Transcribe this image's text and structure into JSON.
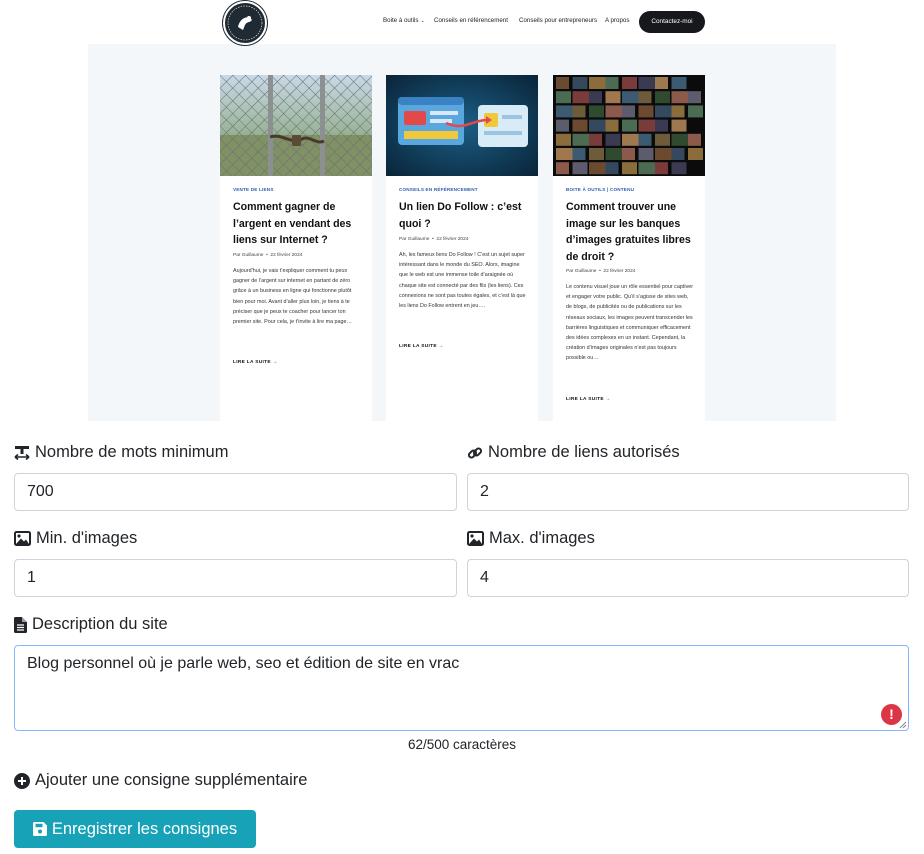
{
  "preview": {
    "nav": {
      "items": [
        "Boite à outils",
        "Conseils en référencement",
        "Conseils pour entrepreneurs",
        "A propos"
      ],
      "cta": "Contactez-moi"
    },
    "cards": [
      {
        "category": "VENTE DE LIENS",
        "title": "Comment gagner de l’argent en vendant des liens sur Internet ?",
        "author": "Par Guillaume",
        "date": "22 février 2024",
        "excerpt": "Aujourd’hui, je vais t’expliquer comment tu peux gagner de l’argent sur internet en partant de zéro grâce à un business en ligne qui fonctionne plutôt bien pour moi. Avant d’aller plus loin, je tiens à te préciser que je peux te coacher pour lancer ton premier site. Pour cela, je t’invite à lire ma page…",
        "more": "LIRE LA SUITE →"
      },
      {
        "category": "CONSEILS EN RÉFÉRENCEMENT",
        "title": "Un lien Do Follow : c’est quoi ?",
        "author": "Par Guillaume",
        "date": "22 février 2024",
        "excerpt": "Ah, les fameux liens Do Follow ! C’est un sujet super intéressant dans le monde du SEO. Alors, imagine que le web est une immense toile d’araignée où chaque site est connecté par des fils (les liens). Ces connexions ne sont pas toutes égales, et c’est là que les liens Do Follow entrent en jeu….",
        "more": "LIRE LA SUITE →"
      },
      {
        "category": "BOITE À OUTILS | CONTENU",
        "title": "Comment trouver une image sur les banques d’images gratuites libres de droit ?",
        "author": "Par Guillaume",
        "date": "22 février 2024",
        "excerpt": "Le contenu visuel joue un rôle essentiel pour captiver et engager votre public. Qu’il s’agisse de sites web, de blogs, de publicités ou de publications sur les réseaux sociaux, les images peuvent transcender les barrières linguistiques et communiquer efficacement des idées complexes en un instant. Cependant, la création d’images originales n’est pas toujours possible ou…",
        "more": "LIRE LA SUITE →"
      }
    ]
  },
  "form": {
    "min_words": {
      "label": "Nombre de mots minimum",
      "value": "700"
    },
    "max_links": {
      "label": "Nombre de liens autorisés",
      "value": "2"
    },
    "min_images": {
      "label": "Min. d'images",
      "value": "1"
    },
    "max_images": {
      "label": "Max. d'images",
      "value": "4"
    },
    "description": {
      "label": "Description du site",
      "value": "Blog personnel où je parle web, seo et édition de site en vrac",
      "counter": "62/500 caractères"
    },
    "add_instruction": "Ajouter une consigne supplémentaire",
    "save_button": "Enregistrer les consignes"
  },
  "colors": {
    "accent": "#17a2b8",
    "error": "#dc3545",
    "focus_border": "#86b7fe",
    "category": "#2a5db0"
  }
}
